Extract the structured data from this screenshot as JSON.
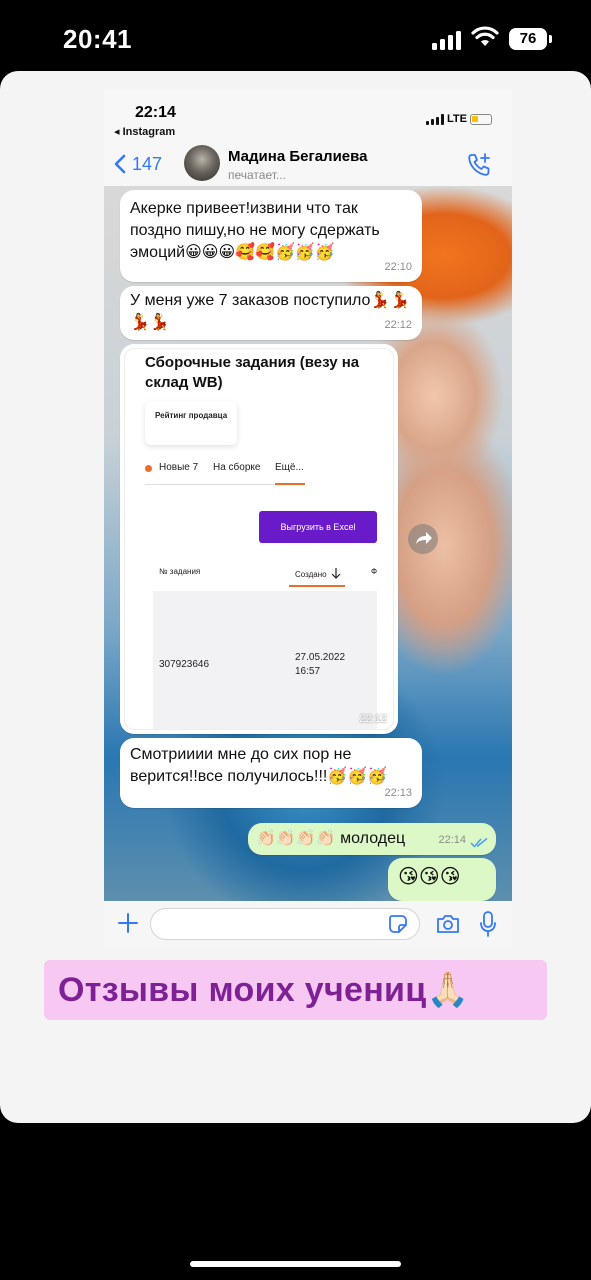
{
  "outer_status": {
    "time": "20:41",
    "battery": "76"
  },
  "inner_status": {
    "time": "22:14",
    "back_label": "◂ Instagram",
    "network": "LTE"
  },
  "chat_header": {
    "back_count": "147",
    "contact_name": "Мадина Бегалиева",
    "contact_status": "печатает..."
  },
  "messages": [
    {
      "text": "Акерке привеет!извини что так поздно пишу,но не могу сдержать эмоций😀😀😀🥰🥰🥳🥳🥳",
      "time": "22:10"
    },
    {
      "text": "У меня уже 7 заказов поступило💃💃💃💃",
      "time": "22:12"
    },
    {
      "text": "Смотрииии мне до сих пор не верится!!все получилось!!!🥳🥳🥳",
      "time": "22:13"
    }
  ],
  "image_message": {
    "title": "Сборочные задания (везу на склад WB)",
    "rating_label": "Рейтинг продавца",
    "tabs": [
      "Новые 7",
      "На сборке",
      "Ещё..."
    ],
    "export_button": "Выгрузить в Excel",
    "col_number": "№ задания",
    "col_created": "Создано",
    "col_extra": "Ф",
    "order_number": "307923646",
    "order_date": "27.05.2022",
    "order_time": "16:57",
    "time": "22:12"
  },
  "outgoing": [
    {
      "text": "👏🏻👏🏻👏🏻👏🏻 молодец",
      "time": "22:14"
    },
    {
      "text": "😘😘😘"
    }
  ],
  "caption": "Отзывы моих учениц🙏🏻",
  "colors": {
    "ios_blue": "#3478f6",
    "outgoing_bubble": "#dcf8c6",
    "caption_bg": "#f7c8f2",
    "caption_text": "#7d2194",
    "wb_purple": "#6a1bc9",
    "wb_orange": "#ea6d2c"
  }
}
